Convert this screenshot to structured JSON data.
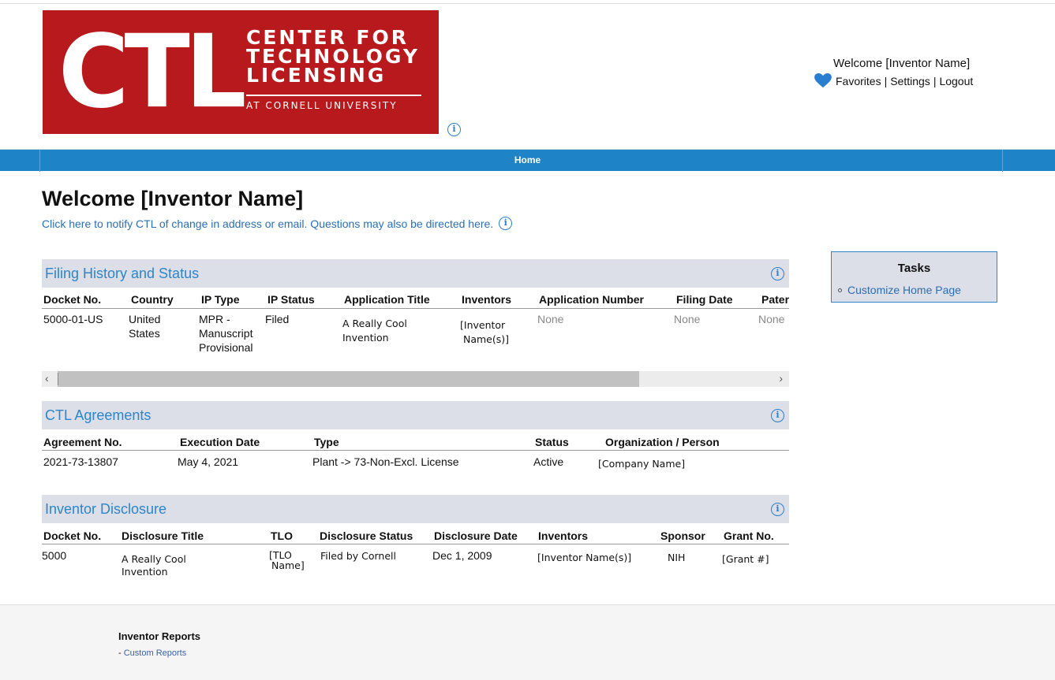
{
  "logo": {
    "big": "CTL",
    "lines": [
      "CENTER FOR",
      "TECHNOLOGY",
      "LICENSING"
    ],
    "sub": "AT CORNELL UNIVERSITY",
    "color": "#b7191c"
  },
  "header": {
    "welcome": "Welcome [Inventor Name]",
    "links": [
      "Favorites",
      "Settings",
      "Logout"
    ],
    "separator": "|"
  },
  "nav": {
    "home": "Home",
    "color": "#1f84c7"
  },
  "page": {
    "title": "Welcome [Inventor Name]",
    "notify": "Click here to notify CTL of change in address or email. Questions may also be directed here."
  },
  "filing": {
    "title": "Filing History and Status",
    "headers": [
      "Docket No.",
      "Country",
      "IP Type",
      "IP Status",
      "Application Title",
      "Inventors",
      "Application Number",
      "Filing Date",
      "Pater"
    ],
    "row": {
      "docket": "5000-01-US",
      "country": [
        "United",
        "States"
      ],
      "ip_type": [
        "MPR -",
        "Manuscript",
        "Provisional"
      ],
      "ip_status": "Filed",
      "app_title": [
        "A Really Cool",
        "Invention"
      ],
      "inventors": [
        "[Inventor",
        "Name(s)]"
      ],
      "app_number": "None",
      "filing_date": "None",
      "patent": "None"
    },
    "scroll_left": "‹",
    "scroll_right": "›"
  },
  "agreements": {
    "title": "CTL Agreements",
    "headers": [
      "Agreement No.",
      "Execution Date",
      "Type",
      "Status",
      "Organization / Person"
    ],
    "row": {
      "number": "2021-73-13807",
      "date": "May 4, 2021",
      "type": "Plant -> 73-Non-Excl. License",
      "status": "Active",
      "org": "[Company Name]"
    }
  },
  "disclosure": {
    "title": "Inventor Disclosure",
    "headers": [
      "Docket No.",
      "Disclosure Title",
      "TLO",
      "Disclosure Status",
      "Disclosure Date",
      "Inventors",
      "Sponsor",
      "Grant No."
    ],
    "row": {
      "docket": "5000",
      "title": [
        "A Really Cool",
        "Invention"
      ],
      "tlo": [
        "[TLO",
        "Name]"
      ],
      "status": "Filed by Cornell",
      "date": "Dec 1, 2009",
      "inventors": "[Inventor Name(s)]",
      "sponsor": "NIH",
      "grant": "[Grant #]"
    }
  },
  "tasks": {
    "title": "Tasks",
    "items": [
      "Customize Home Page"
    ]
  },
  "footer": {
    "title": "Inventor Reports",
    "link_prefix": "- ",
    "link": "Custom Reports"
  },
  "icons": {
    "info": "info-icon",
    "heart": "heart-icon"
  }
}
